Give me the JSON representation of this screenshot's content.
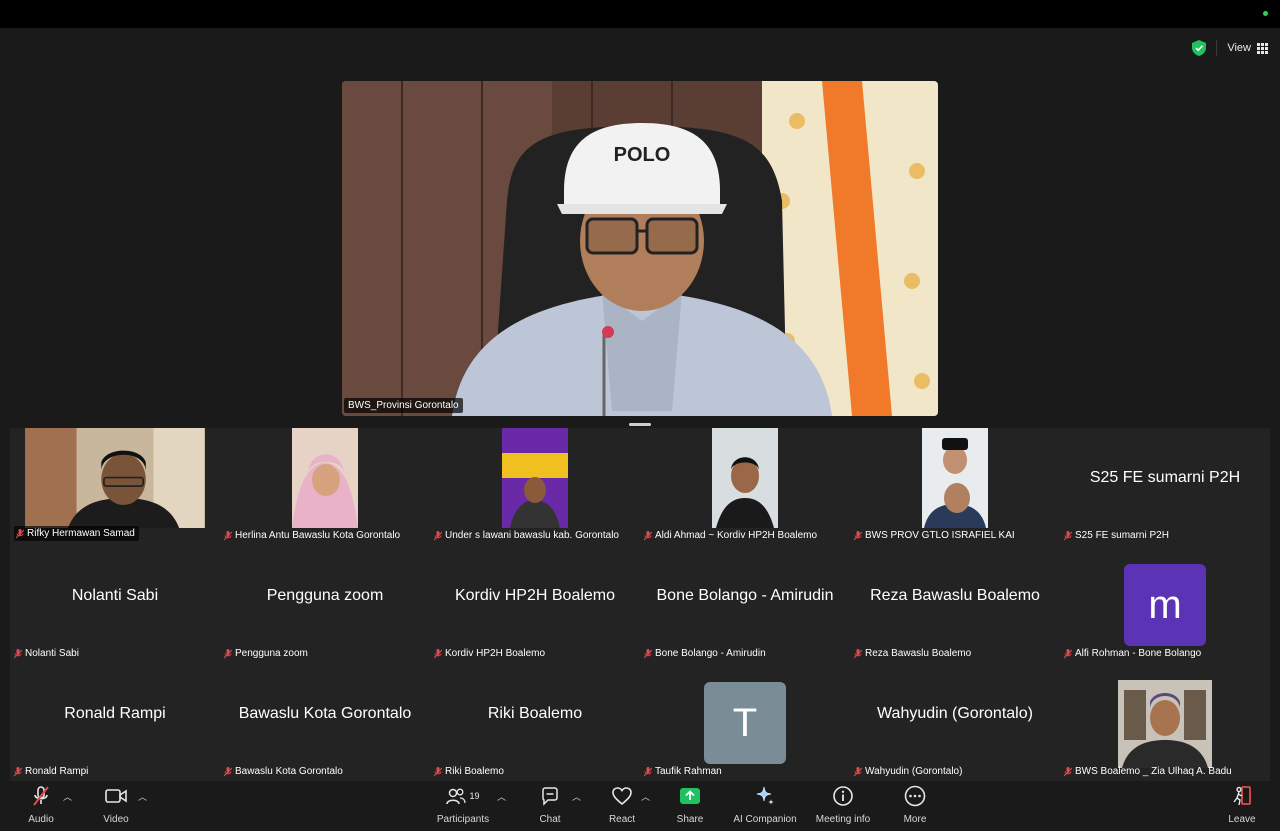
{
  "top": {
    "view_label": "View"
  },
  "speaker": {
    "name": "BWS_Provinsi Gorontalo",
    "cap_text": "POLO"
  },
  "gallery": {
    "row1": [
      {
        "label": "Rifky Hermawan Samad"
      },
      {
        "label": "Herlina Antu Bawaslu Kota Gorontalo"
      },
      {
        "label": "Under s lawani bawaslu kab. Gorontalo"
      },
      {
        "label": "Aldi Ahmad ~ Kordiv HP2H Boalemo"
      },
      {
        "label": "BWS PROV GTLO ISRAFIEL KAI"
      },
      {
        "label": "S25 FE sumarni P2H",
        "display": "S25 FE sumarni P2H"
      }
    ],
    "row2": [
      {
        "label": "Nolanti Sabi",
        "display": "Nolanti Sabi"
      },
      {
        "label": "Pengguna zoom",
        "display": "Pengguna zoom"
      },
      {
        "label": "Kordiv HP2H Boalemo",
        "display": "Kordiv HP2H Boalemo"
      },
      {
        "label": "Bone Bolango - Amirudin",
        "display": "Bone Bolango - Amirudin"
      },
      {
        "label": "Reza Bawaslu Boalemo",
        "display": "Reza Bawaslu Boalemo"
      },
      {
        "label": "Alfi Rohman - Bone Bolango",
        "avatar": "m",
        "avatar_color": "#5b34b6"
      }
    ],
    "row3": [
      {
        "label": "Ronald Rampi",
        "display": "Ronald Rampi"
      },
      {
        "label": "Bawaslu Kota Gorontalo",
        "display": "Bawaslu Kota Gorontalo"
      },
      {
        "label": "Riki Boalemo",
        "display": "Riki Boalemo"
      },
      {
        "label": "Taufik Rahman",
        "avatar": "T",
        "avatar_color": "#7a8c96"
      },
      {
        "label": "Wahyudin (Gorontalo)",
        "display": "Wahyudin (Gorontalo)"
      },
      {
        "label": "BWS Boalemo _ Zia Ulhaq A. Badu"
      }
    ]
  },
  "toolbar": {
    "audio": "Audio",
    "video": "Video",
    "participants": "Participants",
    "participants_count": "19",
    "chat": "Chat",
    "react": "React",
    "share": "Share",
    "ai_companion": "AI Companion",
    "meeting_info": "Meeting info",
    "more": "More",
    "leave": "Leave"
  },
  "colors": {
    "accent_green": "#1fc161",
    "leave_red": "#e5484d",
    "mic_off_red": "#e5484d"
  }
}
